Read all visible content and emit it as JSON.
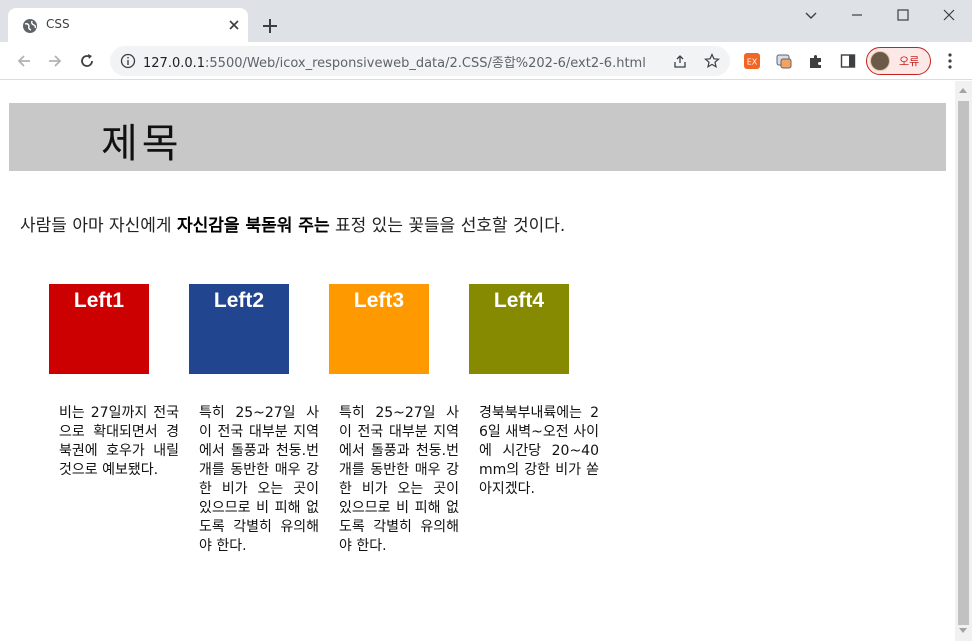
{
  "browser": {
    "tab_title": "CSS",
    "url_host": "127.0.0.1",
    "url_rest": ":5500/Web/icox_responsiveweb_data/2.CSS/종합%202-6/ext2-6.html",
    "profile_label": "오류"
  },
  "page": {
    "heading": "제목",
    "intro_before": "사람들 아마 자신에게 ",
    "intro_bold": "자신감을 북돋워 주는",
    "intro_after": " 표정 있는 꽃들을 선호할 것이다.",
    "cards": [
      {
        "label": "Left1",
        "color": "#cc0000",
        "text": "비는 27일까지 전국으로 확대되면서 경북권에 호우가 내릴 것으로 예보됐다."
      },
      {
        "label": "Left2",
        "color": "#21468f",
        "text": "특히 25~27일 사이 전국 대부분 지역에서 돌풍과 천둥.번개를 동반한 매우 강한 비가 오는 곳이 있으므로 비 피해 없도록 각별히 유의해야 한다."
      },
      {
        "label": "Left3",
        "color": "#ff9900",
        "text": "특히 25~27일 사이 전국 대부분 지역에서 돌풍과 천둥.번개를 동반한 매우 강한 비가 오는 곳이 있으므로 비 피해 없도록 각별히 유의해야 한다."
      },
      {
        "label": "Left4",
        "color": "#858a00",
        "text": "경북북부내륙에는 26일 새벽~오전 사이에 시간당 20~40mm의 강한 비가 쏟아지겠다."
      }
    ]
  },
  "icons": {
    "tab": [
      "globe-icon",
      "close-icon",
      "plus-icon"
    ],
    "window": [
      "chevron-down-icon",
      "minimize-icon",
      "maximize-icon",
      "close-icon"
    ],
    "toolbar": [
      "back-icon",
      "forward-icon",
      "reload-icon",
      "info-icon",
      "share-icon",
      "star-icon",
      "extension-icon",
      "puzzle-icon",
      "sidepanel-icon",
      "kebab-menu-icon"
    ]
  }
}
